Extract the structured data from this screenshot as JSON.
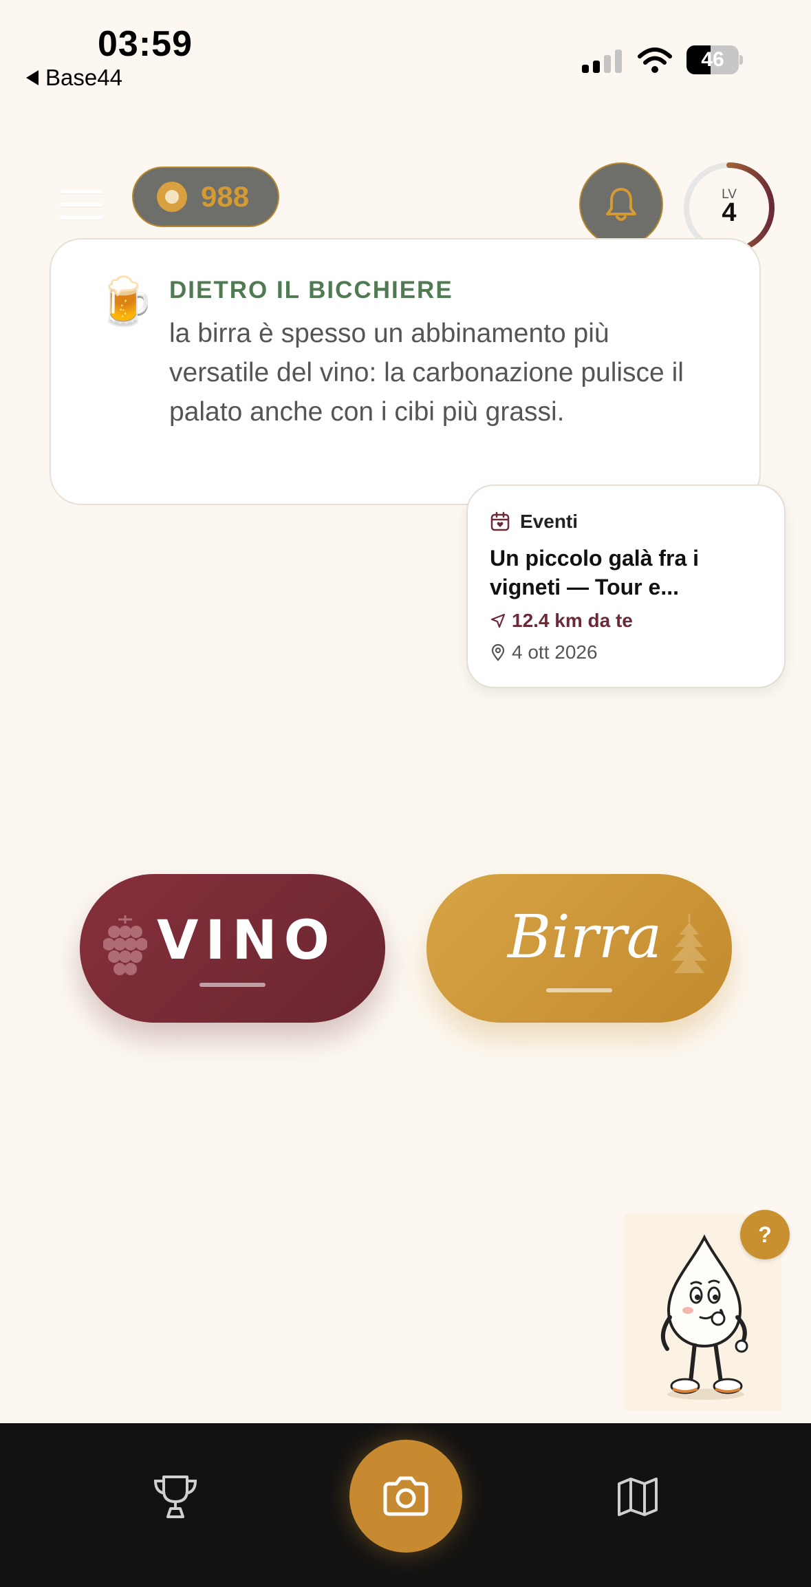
{
  "status_bar": {
    "time": "03:59",
    "back_app": "Base44",
    "battery_level": "46"
  },
  "header": {
    "coins": "988",
    "level_label": "LV",
    "level_value": "4",
    "level_progress": 0.42
  },
  "tip": {
    "emoji": "🍺",
    "title": "DIETRO IL BICCHIERE",
    "text": "la birra è spesso un abbinamento più versatile del vino: la carbonazione pulisce il palato anche con i cibi più grassi."
  },
  "event": {
    "category": "Eventi",
    "title": "Un piccolo galà fra i vigneti — Tour e...",
    "distance": "12.4 km da te",
    "date": "4 ott 2026"
  },
  "buttons": {
    "vino": "VINO",
    "birra": "Birra"
  },
  "help": {
    "label": "?"
  },
  "colors": {
    "background": "#fcf8f1",
    "wine": "#7a2b35",
    "beer": "#cf9a3c",
    "accent_green": "#4f7a52",
    "nav_bg": "#121212"
  },
  "icons": [
    "menu-icon",
    "coin-icon",
    "bell-icon",
    "calendar-icon",
    "navigation-icon",
    "location-pin-icon",
    "grapes-icon",
    "hops-icon",
    "trophy-icon",
    "camera-icon",
    "map-icon"
  ]
}
